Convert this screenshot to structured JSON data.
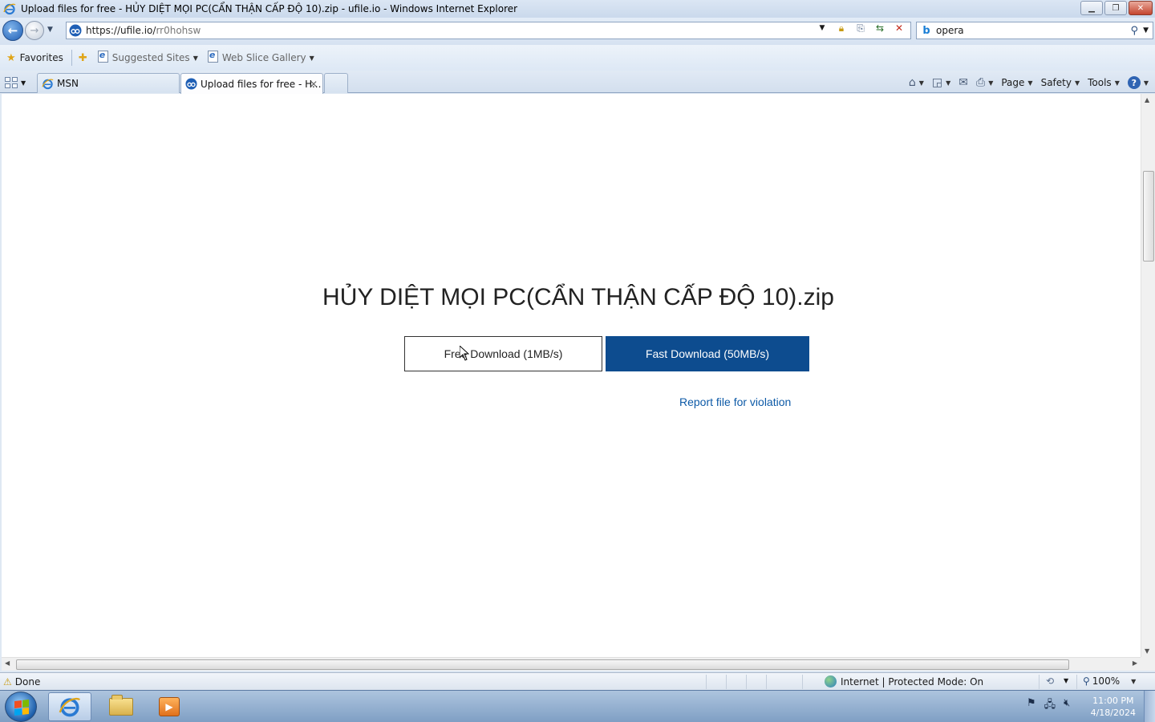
{
  "window": {
    "title": "Upload files for free - HỦY DIỆT MỌI PC(CẨN THẬN CẤP ĐỘ 10).zip - ufile.io - Windows Internet Explorer"
  },
  "address_bar": {
    "url_host": "https://ufile.io/",
    "url_path": "rr0hohsw"
  },
  "search": {
    "query": "opera"
  },
  "favorites_bar": {
    "favorites_label": "Favorites",
    "items": [
      {
        "label": "Suggested Sites"
      },
      {
        "label": "Web Slice Gallery"
      }
    ]
  },
  "tabs": [
    {
      "label": "MSN",
      "active": false
    },
    {
      "label": "Upload files for free - H...",
      "active": true
    }
  ],
  "command_bar": {
    "page": "Page",
    "safety": "Safety",
    "tools": "Tools"
  },
  "page": {
    "file_title": "HỦY DIỆT MỌI PC(CẨN THẬN CẤP ĐỘ 10).zip",
    "free_download": "Free Download (1MB/s)",
    "fast_download": "Fast Download (50MB/s)",
    "report_link": "Report file for violation"
  },
  "status_bar": {
    "status": "Done",
    "zone": "Internet | Protected Mode: On",
    "zoom": "100%"
  },
  "taskbar": {
    "time": "11:00 PM",
    "date": "4/18/2024"
  },
  "colors": {
    "fast_button_bg": "#0d4c8f",
    "link": "#0d5aa7"
  }
}
